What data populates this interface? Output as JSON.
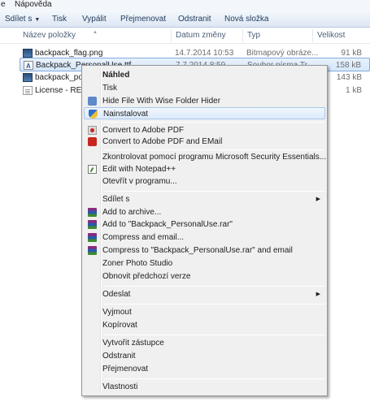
{
  "menubar": {
    "items": [
      "e",
      "Nápověda"
    ]
  },
  "toolbar": {
    "share_label": "Sdílet s",
    "print_label": "Tisk",
    "burn_label": "Vypálit",
    "rename_label": "Přejmenovat",
    "delete_label": "Odstranit",
    "new_folder_label": "Nová složka"
  },
  "columns": {
    "name": "Název položky",
    "date": "Datum změny",
    "type": "Typ",
    "size": "Velikost"
  },
  "files": [
    {
      "name": "backpack_flag.png",
      "date": "14.7.2014 10:53",
      "type": "Bitmapový obráze...",
      "size": "91 kB",
      "icon": "image-file-icon"
    },
    {
      "name": "Backpack_PersonalUse.ttf",
      "date": "7.7.2014 8:59",
      "type": "Soubor písma Tr...",
      "size": "158 kB",
      "icon": "font-file-icon"
    },
    {
      "name": "backpack_post",
      "date": "",
      "type": "",
      "size": "143 kB",
      "icon": "image-file-icon"
    },
    {
      "name": "License - READ",
      "date": "",
      "type": "",
      "size": "1 kB",
      "icon": "text-file-icon"
    }
  ],
  "context_menu": {
    "preview": "Náhled",
    "print": "Tisk",
    "hide_file": "Hide File With Wise Folder Hider",
    "install": "Nainstalovat",
    "convert_pdf": "Convert to Adobe PDF",
    "convert_pdf_email": "Convert to Adobe PDF and EMail",
    "scan_mse": "Zkontrolovat pomocí programu Microsoft Security Essentials...",
    "edit_notepad": "Edit with Notepad++",
    "open_with": "Otevřít v programu...",
    "share_with": "Sdílet s",
    "add_archive": "Add to archive...",
    "add_rar": "Add to \"Backpack_PersonalUse.rar\"",
    "compress_email": "Compress and email...",
    "compress_rar_email": "Compress to \"Backpack_PersonalUse.rar\" and email",
    "zoner": "Zoner Photo Studio",
    "restore_versions": "Obnovit předchozí verze",
    "send_to": "Odeslat",
    "cut": "Vyjmout",
    "copy": "Kopírovat",
    "create_shortcut": "Vytvořit zástupce",
    "delete": "Odstranit",
    "rename": "Přejmenovat",
    "properties": "Vlastnosti"
  }
}
